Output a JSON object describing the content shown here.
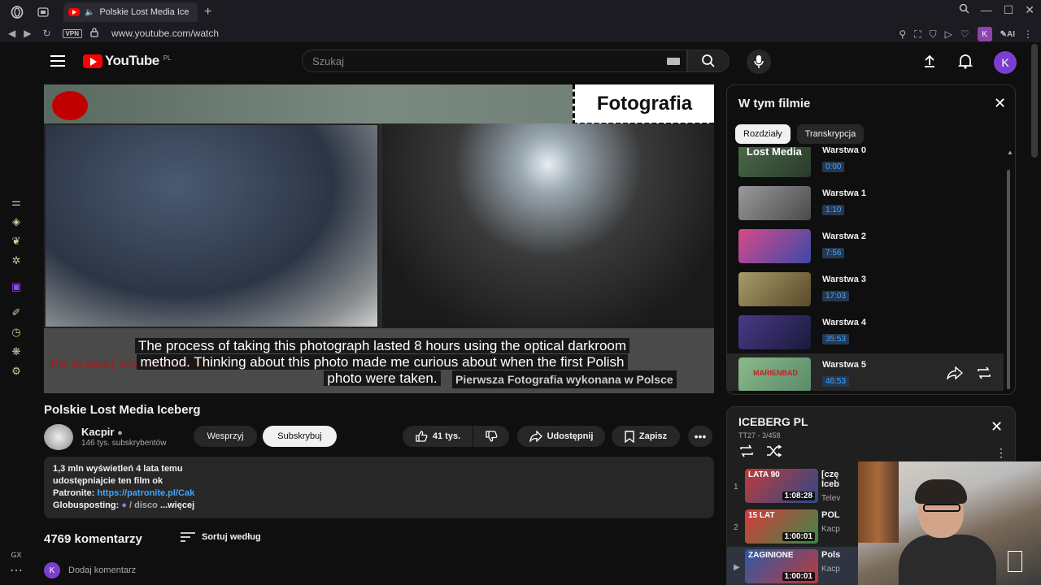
{
  "browser": {
    "tab_title": "Polskie Lost Media Ice",
    "url": "www.youtube.com/watch",
    "vpn_label": "VPN",
    "ai_label": "AI",
    "profile_letter": "K",
    "gx_label": "GX"
  },
  "header": {
    "logo_text": "YouTube",
    "logo_region": "PL",
    "search_placeholder": "Szukaj",
    "avatar_letter": "K"
  },
  "video": {
    "overlay_label": "Fotografia",
    "subtitle_lines": [
      "The process of taking this photograph lasted 8 hours using the optical darkroom",
      "method. Thinking about this photo made me curious about when the first Polish",
      "photo were taken."
    ],
    "burned_caption": "Pierwsza Fotografia wykonana w Polsce",
    "burned_red_text": "Po prawej wersja koloro"
  },
  "title": "Polskie Lost Media Iceberg",
  "channel": {
    "name": "Kacpir",
    "subscribers": "146 tys. subskrybentów",
    "support_label": "Wesprzyj",
    "subscribe_label": "Subskrybuj"
  },
  "actions": {
    "likes": "41 tys.",
    "share_label": "Udostępnij",
    "save_label": "Zapisz"
  },
  "description": {
    "stats": "1,3 mln wyświetleń  4 lata temu",
    "line1": "udostępniajcie ten film ok",
    "patronite_label": "Patronite: ",
    "patronite_link": "https://patronite.pl/Cak",
    "globus_label": "Globusposting: ",
    "globus_rest": " / disco",
    "more_label": " ...więcej"
  },
  "comments": {
    "count_label": "4769 komentarzy",
    "sort_label": "Sortuj według",
    "add_placeholder": "Dodaj komentarz",
    "avatar_letter": "K"
  },
  "chapters_panel": {
    "title": "W tym filmie",
    "tabs": [
      {
        "label": "Rozdziały",
        "active": true
      },
      {
        "label": "Transkrypcja",
        "active": false
      }
    ],
    "items": [
      {
        "name": "Warstwa 0",
        "time": "0:00",
        "thumb_text": "Lost Media",
        "color": "#3a5a3a"
      },
      {
        "name": "Warstwa 1",
        "time": "1:10",
        "thumb_text": "",
        "color": "#8a8a8a"
      },
      {
        "name": "Warstwa 2",
        "time": "7:56",
        "thumb_text": "",
        "color": "#c03a6a"
      },
      {
        "name": "Warstwa 3",
        "time": "17:03",
        "thumb_text": "",
        "color": "#8a7a4a"
      },
      {
        "name": "Warstwa 4",
        "time": "35:53",
        "thumb_text": "",
        "color": "#3a2a6a"
      },
      {
        "name": "Warstwa 5",
        "time": "46:53",
        "thumb_text": "MARIENBAD",
        "color": "#6a9a6a"
      }
    ]
  },
  "playlist": {
    "title": "ICEBERG PL",
    "subtitle": "TT27 - 3/458",
    "items": [
      {
        "index": "1",
        "title": "[czę",
        "title2": "Iceb",
        "channel": "Telev",
        "duration": "1:08:28",
        "thumb_text": "LATA 90",
        "color": "#2a4a8a"
      },
      {
        "index": "2",
        "title": "POL",
        "title2": "",
        "channel": "Kacp",
        "duration": "1:00:01",
        "thumb_text": "15 LAT",
        "color": "#3a7a3a"
      },
      {
        "index": "▶",
        "title": "Pols",
        "title2": "",
        "channel": "Kacp",
        "duration": "1:00:01",
        "thumb_text": "ZAGINIONE",
        "color": "#2a5aa8"
      }
    ]
  }
}
